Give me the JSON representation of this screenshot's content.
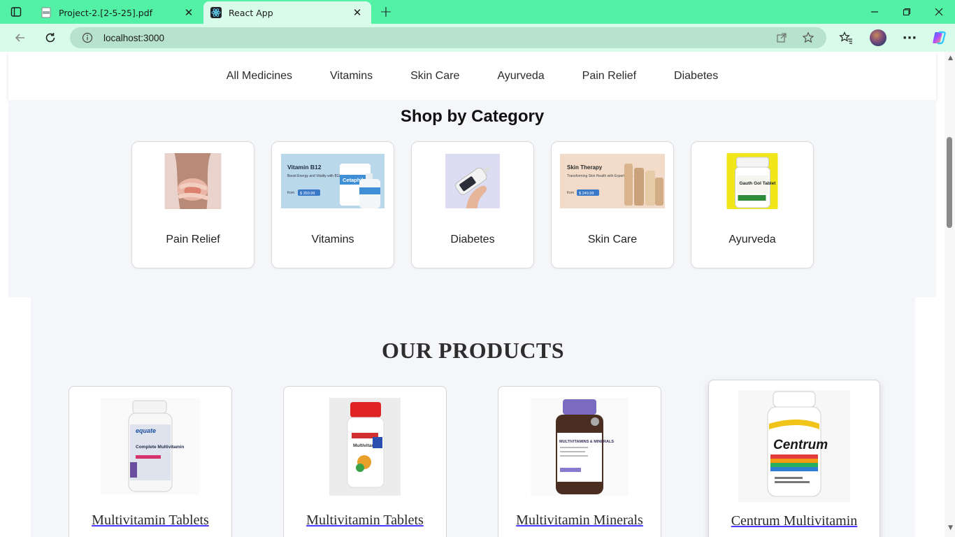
{
  "browser": {
    "tabs": [
      {
        "title": "Project-2.[2-5-25].pdf",
        "favicon": "pdf-icon",
        "active": false
      },
      {
        "title": "React App",
        "favicon": "react-icon",
        "active": true
      }
    ],
    "url": "localhost:3000"
  },
  "nav": {
    "items": [
      "All Medicines",
      "Vitamins",
      "Skin Care",
      "Ayurveda",
      "Pain Relief",
      "Diabetes"
    ]
  },
  "shop": {
    "title": "Shop by Category",
    "categories": [
      {
        "label": "Pain Relief",
        "image": "stomach-pain-photo"
      },
      {
        "label": "Vitamins",
        "image": "vitamin-b12-banner",
        "banner_title": "Vitamin B12",
        "banner_sub": "Boost Energy and Vitality with B12 Care",
        "banner_from": "from",
        "banner_price": "$ 359.99",
        "banner_brand": "Cetaphil"
      },
      {
        "label": "Diabetes",
        "image": "glucometer-photo"
      },
      {
        "label": "Skin Care",
        "image": "skin-therapy-banner",
        "banner_title": "Skin Therapy",
        "banner_sub": "Transforming Skin Health with Expert Care",
        "banner_from": "from",
        "banner_price": "$ 249.99"
      },
      {
        "label": "Ayurveda",
        "image": "ayurveda-tablet-bottle",
        "bottle_text": "Gauth Gol Tablet"
      }
    ]
  },
  "products": {
    "title": "OUR PRODUCTS",
    "items": [
      {
        "name": "Multivitamin Tablets",
        "image": "equate-multivitamin-bottle",
        "brand": "equate",
        "label": "Complete Multivitamin"
      },
      {
        "name": "Multivitamin Tablets",
        "image": "red-cap-multivitamin-bottle",
        "label": "Multivitamin"
      },
      {
        "name": "Multivitamin Minerals",
        "image": "multivitamins-minerals-bottle",
        "label": "MULTIVITAMINS & MINERALS"
      },
      {
        "name": "Centrum Multivitamin",
        "image": "centrum-bottle",
        "brand": "Centrum"
      }
    ]
  },
  "colors": {
    "tabbar": "#52f1a6",
    "toolbar": "#d9fbe9",
    "section_bg": "#f4f6f9",
    "link_underline": "#4a3aff"
  }
}
